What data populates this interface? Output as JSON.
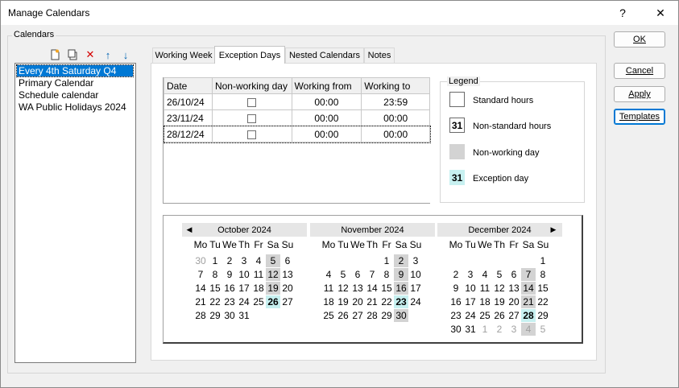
{
  "window": {
    "title": "Manage Calendars",
    "help_label": "?",
    "close_label": "✕"
  },
  "calendars": {
    "group_label": "Calendars",
    "items": [
      {
        "label": "Every 4th Saturday Q4",
        "selected": true
      },
      {
        "label": "Primary Calendar",
        "selected": false
      },
      {
        "label": "Schedule calendar",
        "selected": false
      },
      {
        "label": "WA Public Holidays 2024",
        "selected": false
      }
    ]
  },
  "buttons": {
    "ok": "OK",
    "cancel": "Cancel",
    "apply": "Apply",
    "templates": "Templates"
  },
  "tabs": [
    {
      "label": "Working Week",
      "active": false
    },
    {
      "label": "Exception Days",
      "active": true
    },
    {
      "label": "Nested Calendars",
      "active": false
    },
    {
      "label": "Notes",
      "active": false
    }
  ],
  "exceptions": {
    "columns": [
      "Date",
      "Non-working day",
      "Working from",
      "Working to"
    ],
    "rows": [
      {
        "date": "26/10/24",
        "nonworking": false,
        "from": "00:00",
        "to": "23:59"
      },
      {
        "date": "23/11/24",
        "nonworking": false,
        "from": "00:00",
        "to": "00:00"
      },
      {
        "date": "28/12/24",
        "nonworking": false,
        "from": "00:00",
        "to": "00:00"
      }
    ]
  },
  "legend": {
    "title": "Legend",
    "items": [
      {
        "label": "Standard hours",
        "sample": ""
      },
      {
        "label": "Non-standard hours",
        "sample": "31"
      },
      {
        "label": "Non-working day",
        "sample": ""
      },
      {
        "label": "Exception day",
        "sample": "31"
      }
    ],
    "colors": {
      "nonworking": "#d3d3d3",
      "exception": "#c7f0f0"
    }
  },
  "calendar_view": {
    "prev_icon": "◀",
    "next_icon": "▶",
    "dow": [
      "Mo",
      "Tu",
      "We",
      "Th",
      "Fr",
      "Sa",
      "Su"
    ],
    "months": [
      {
        "title": "October 2024",
        "weeks": [
          [
            {
              "d": "30",
              "gray": true
            },
            {
              "d": "1"
            },
            {
              "d": "2"
            },
            {
              "d": "3"
            },
            {
              "d": "4"
            },
            {
              "d": "5",
              "wk": true
            },
            {
              "d": "6"
            }
          ],
          [
            {
              "d": "7"
            },
            {
              "d": "8"
            },
            {
              "d": "9"
            },
            {
              "d": "10"
            },
            {
              "d": "11"
            },
            {
              "d": "12",
              "wk": true
            },
            {
              "d": "13"
            }
          ],
          [
            {
              "d": "14"
            },
            {
              "d": "15"
            },
            {
              "d": "16"
            },
            {
              "d": "17"
            },
            {
              "d": "18"
            },
            {
              "d": "19",
              "wk": true
            },
            {
              "d": "20"
            }
          ],
          [
            {
              "d": "21"
            },
            {
              "d": "22"
            },
            {
              "d": "23"
            },
            {
              "d": "24"
            },
            {
              "d": "25"
            },
            {
              "d": "26",
              "exc": true
            },
            {
              "d": "27"
            }
          ],
          [
            {
              "d": "28"
            },
            {
              "d": "29"
            },
            {
              "d": "30"
            },
            {
              "d": "31"
            }
          ]
        ]
      },
      {
        "title": "November 2024",
        "weeks": [
          [
            null,
            null,
            null,
            null,
            {
              "d": "1"
            },
            {
              "d": "2",
              "wk": true
            },
            {
              "d": "3"
            }
          ],
          [
            {
              "d": "4"
            },
            {
              "d": "5"
            },
            {
              "d": "6"
            },
            {
              "d": "7"
            },
            {
              "d": "8"
            },
            {
              "d": "9",
              "wk": true
            },
            {
              "d": "10"
            }
          ],
          [
            {
              "d": "11"
            },
            {
              "d": "12"
            },
            {
              "d": "13"
            },
            {
              "d": "14"
            },
            {
              "d": "15"
            },
            {
              "d": "16",
              "wk": true
            },
            {
              "d": "17"
            }
          ],
          [
            {
              "d": "18"
            },
            {
              "d": "19"
            },
            {
              "d": "20"
            },
            {
              "d": "21"
            },
            {
              "d": "22"
            },
            {
              "d": "23",
              "exc": true
            },
            {
              "d": "24"
            }
          ],
          [
            {
              "d": "25"
            },
            {
              "d": "26"
            },
            {
              "d": "27"
            },
            {
              "d": "28"
            },
            {
              "d": "29"
            },
            {
              "d": "30",
              "wk": true
            }
          ]
        ]
      },
      {
        "title": "December 2024",
        "weeks": [
          [
            null,
            null,
            null,
            null,
            null,
            null,
            {
              "d": "1"
            }
          ],
          [
            {
              "d": "2"
            },
            {
              "d": "3"
            },
            {
              "d": "4"
            },
            {
              "d": "5"
            },
            {
              "d": "6"
            },
            {
              "d": "7",
              "wk": true
            },
            {
              "d": "8"
            }
          ],
          [
            {
              "d": "9"
            },
            {
              "d": "10"
            },
            {
              "d": "11"
            },
            {
              "d": "12"
            },
            {
              "d": "13"
            },
            {
              "d": "14",
              "wk": true
            },
            {
              "d": "15"
            }
          ],
          [
            {
              "d": "16"
            },
            {
              "d": "17"
            },
            {
              "d": "18"
            },
            {
              "d": "19"
            },
            {
              "d": "20"
            },
            {
              "d": "21",
              "wk": true
            },
            {
              "d": "22"
            }
          ],
          [
            {
              "d": "23"
            },
            {
              "d": "24"
            },
            {
              "d": "25"
            },
            {
              "d": "26"
            },
            {
              "d": "27"
            },
            {
              "d": "28",
              "exc": true
            },
            {
              "d": "29"
            }
          ],
          [
            {
              "d": "30"
            },
            {
              "d": "31"
            },
            {
              "d": "1",
              "gray": true
            },
            {
              "d": "2",
              "gray": true
            },
            {
              "d": "3",
              "gray": true
            },
            {
              "d": "4",
              "gray": true,
              "wk": true
            },
            {
              "d": "5",
              "gray": true
            }
          ]
        ]
      }
    ]
  }
}
